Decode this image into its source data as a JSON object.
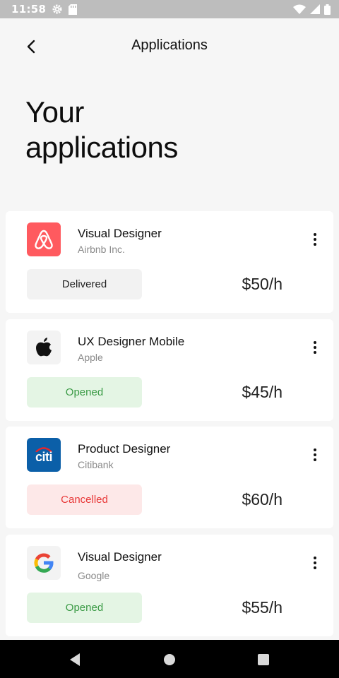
{
  "status_bar": {
    "time": "11:58",
    "icons": [
      "settings-icon",
      "sd-card-icon",
      "wifi-icon",
      "signal-icon",
      "battery-icon"
    ]
  },
  "header": {
    "title": "Applications",
    "back_icon": "chevron-left-icon"
  },
  "page": {
    "title_line1": "Your",
    "title_line2": "applications"
  },
  "colors": {
    "delivered": "#f2f2f2",
    "opened": "#e4f5e4",
    "cancelled": "#fde8e8",
    "airbnb_brand": "#ff5a5f",
    "citi_brand": "#0b5fa8"
  },
  "applications": [
    {
      "title": "Visual Designer",
      "company": "Airbnb Inc.",
      "status": "Delivered",
      "rate": "$50/h",
      "logo": "airbnb-logo"
    },
    {
      "title": "UX Designer Mobile",
      "company": "Apple",
      "status": "Opened",
      "rate": "$45/h",
      "logo": "apple-logo"
    },
    {
      "title": "Product Designer",
      "company": "Citibank",
      "status": "Cancelled",
      "rate": "$60/h",
      "logo": "citi-logo",
      "logo_text": "citi"
    },
    {
      "title": "Visual Designer",
      "company": "Google",
      "status": "Opened",
      "rate": "$55/h",
      "logo": "google-logo"
    }
  ],
  "nav_bar": {
    "buttons": [
      "back-triangle-icon",
      "home-circle-icon",
      "recents-square-icon"
    ]
  }
}
